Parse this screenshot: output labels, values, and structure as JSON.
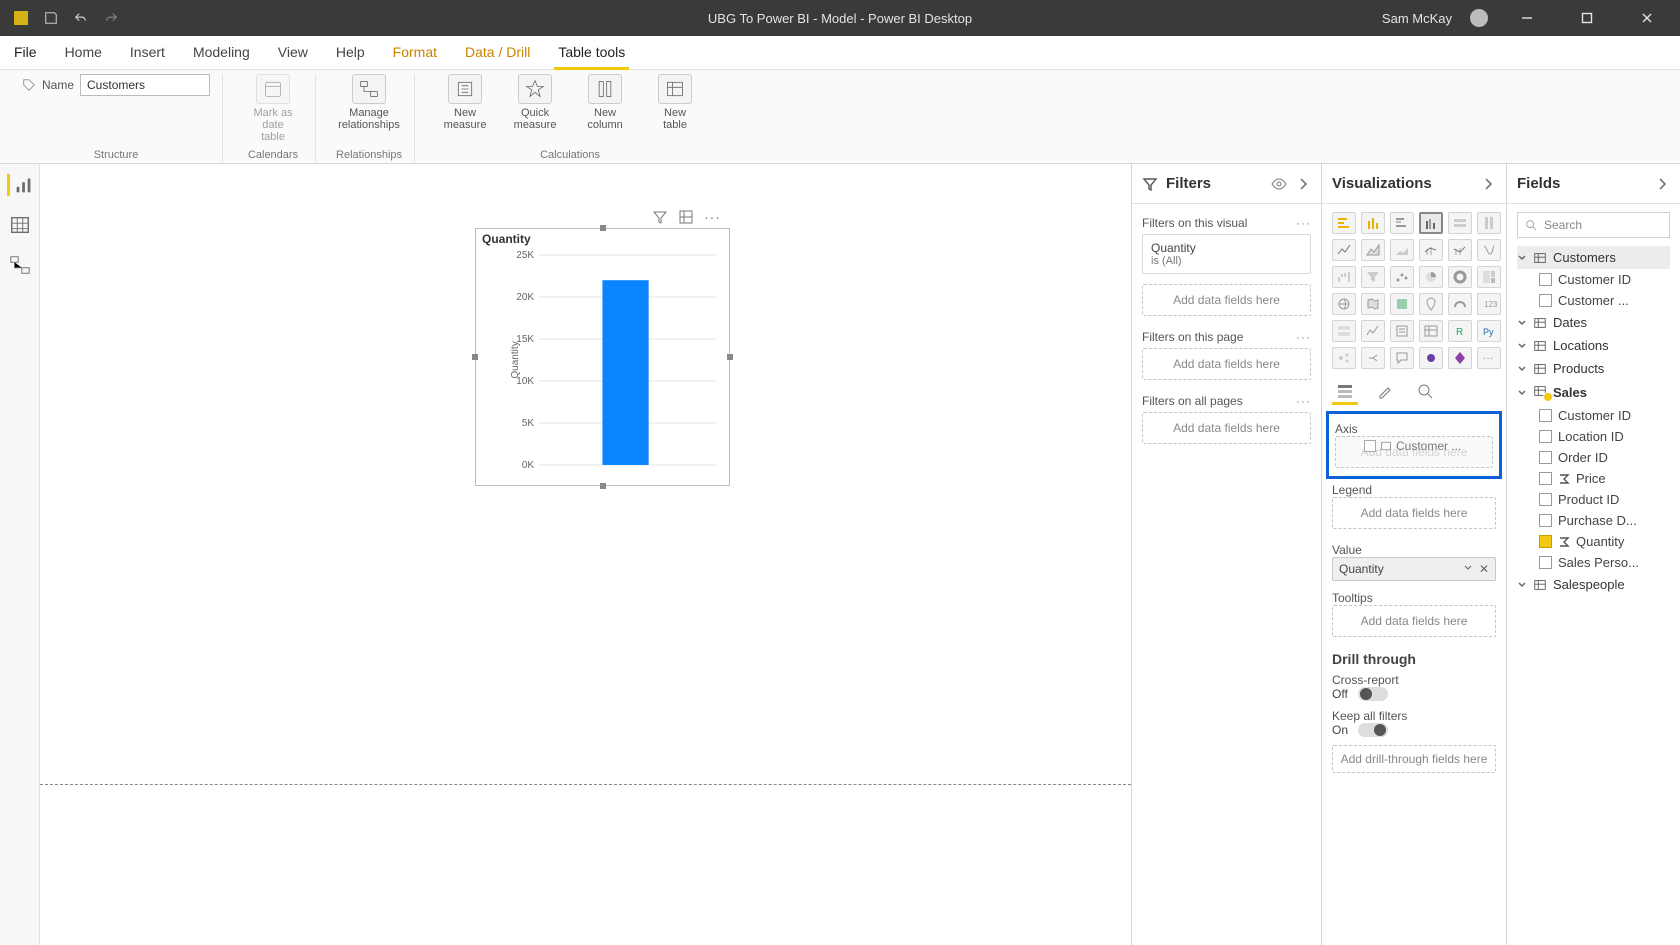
{
  "titlebar": {
    "app_title": "UBG To Power BI - Model - Power BI Desktop",
    "user_name": "Sam McKay"
  },
  "ribbon_tabs": {
    "file": "File",
    "home": "Home",
    "insert": "Insert",
    "modeling": "Modeling",
    "view": "View",
    "help": "Help",
    "format": "Format",
    "data_drill": "Data / Drill",
    "table_tools": "Table tools"
  },
  "ribbon": {
    "name_label": "Name",
    "name_value": "Customers",
    "mark_date": "Mark as date\ntable",
    "manage_rel": "Manage\nrelationships",
    "new_measure": "New\nmeasure",
    "quick_measure": "Quick\nmeasure",
    "new_column": "New\ncolumn",
    "new_table": "New\ntable",
    "grp_structure": "Structure",
    "grp_calendars": "Calendars",
    "grp_relationships": "Relationships",
    "grp_calculations": "Calculations"
  },
  "visual": {
    "title": "Quantity",
    "y_axis_label": "Quantity"
  },
  "chart_data": {
    "type": "bar",
    "title": "Quantity",
    "ylabel": "Quantity",
    "categories": [
      ""
    ],
    "values": [
      22000
    ],
    "ylim": [
      0,
      25000
    ],
    "yticks": [
      "0K",
      "5K",
      "10K",
      "15K",
      "20K",
      "25K"
    ]
  },
  "filters": {
    "title": "Filters",
    "on_visual": "Filters on this visual",
    "quantity_name": "Quantity",
    "quantity_state": "is (All)",
    "on_page": "Filters on this page",
    "on_all": "Filters on all pages",
    "add": "Add data fields here"
  },
  "viz": {
    "title": "Visualizations",
    "axis": "Axis",
    "axis_placeholder": "Add data fields here",
    "drag_ghost": "Customer ...",
    "legend": "Legend",
    "legend_placeholder": "Add data fields here",
    "value": "Value",
    "value_field": "Quantity",
    "tooltips": "Tooltips",
    "tooltips_placeholder": "Add data fields here",
    "drill_title": "Drill through",
    "cross_report": "Cross-report",
    "cross_report_state": "Off",
    "keep_filters": "Keep all filters",
    "keep_filters_state": "On",
    "drill_add": "Add drill-through fields here"
  },
  "fields": {
    "title": "Fields",
    "search_placeholder": "Search",
    "tables": {
      "customers": {
        "name": "Customers",
        "expanded": true,
        "fields": [
          "Customer ID",
          "Customer ..."
        ]
      },
      "dates": {
        "name": "Dates"
      },
      "locations": {
        "name": "Locations"
      },
      "products": {
        "name": "Products"
      },
      "sales": {
        "name": "Sales",
        "expanded": true,
        "fields": [
          {
            "name": "Customer ID"
          },
          {
            "name": "Location ID"
          },
          {
            "name": "Order ID"
          },
          {
            "name": "Price",
            "sigma": true
          },
          {
            "name": "Product ID"
          },
          {
            "name": "Purchase D..."
          },
          {
            "name": "Quantity",
            "sigma": true,
            "checked": true
          },
          {
            "name": "Sales Perso..."
          }
        ]
      },
      "salespeople": {
        "name": "Salespeople"
      }
    }
  }
}
